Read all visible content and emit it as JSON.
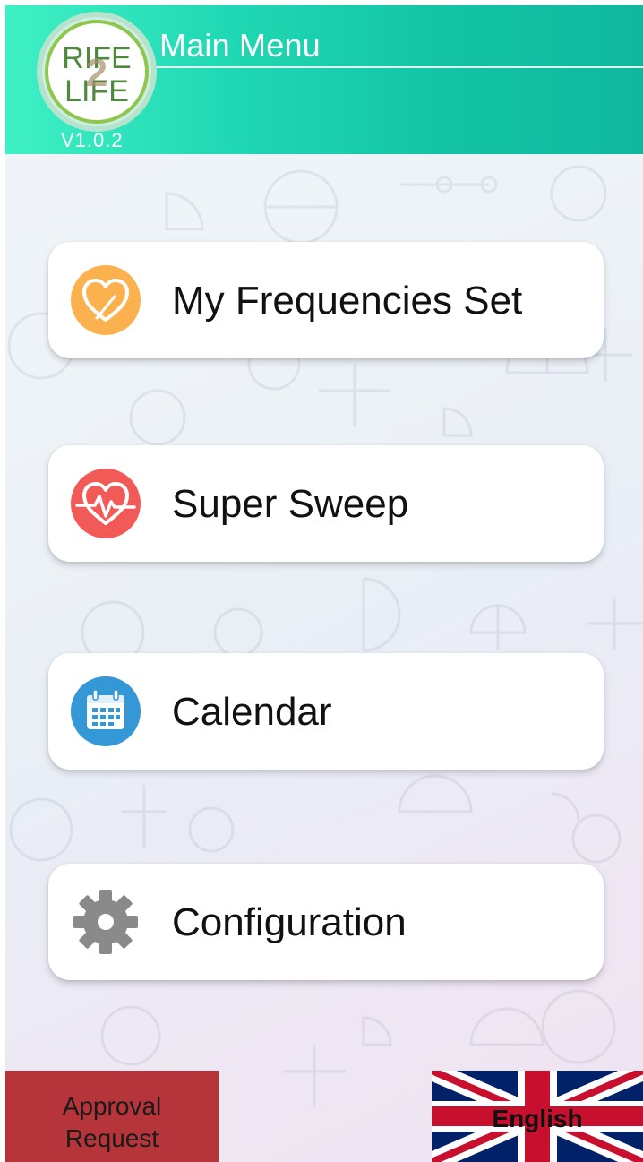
{
  "header": {
    "title": "Main Menu",
    "logo_text": "RIFE 2 LIFE",
    "version": "V1.0.2"
  },
  "menu": {
    "items": [
      {
        "label": "My Frequencies Set",
        "icon": "heart-icon",
        "icon_color": "#fbb24e"
      },
      {
        "label": "Super Sweep",
        "icon": "heartbeat-icon",
        "icon_color": "#f25a57"
      },
      {
        "label": "Calendar",
        "icon": "calendar-icon",
        "icon_color": "#3498d6"
      },
      {
        "label": "Configuration",
        "icon": "gear-icon",
        "icon_color": "#8a8a8a"
      }
    ]
  },
  "footer": {
    "approval_line1": "Approval",
    "approval_line2": "Request",
    "language": "English",
    "language_flag": "uk-flag-icon"
  },
  "colors": {
    "header_start": "#3ff0c4",
    "header_end": "#0fb89d",
    "approval_bg": "#b5353a"
  }
}
